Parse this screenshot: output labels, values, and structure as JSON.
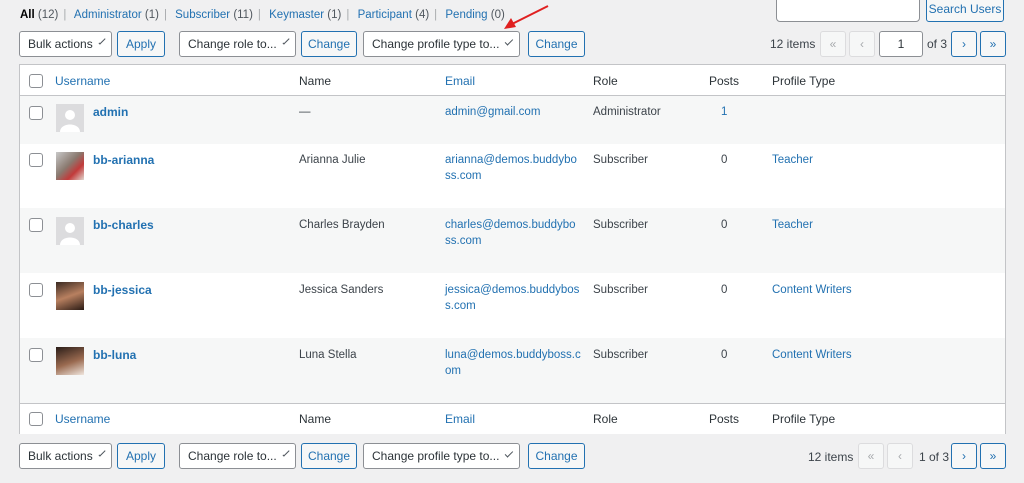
{
  "filters": [
    {
      "label": "All",
      "count": "(12)",
      "current": true
    },
    {
      "label": "Administrator",
      "count": "(1)"
    },
    {
      "label": "Subscriber",
      "count": "(11)"
    },
    {
      "label": "Keymaster",
      "count": "(1)"
    },
    {
      "label": "Participant",
      "count": "(4)"
    },
    {
      "label": "Pending",
      "count": "(0)"
    }
  ],
  "search": {
    "button": "Search Users",
    "value": ""
  },
  "toolbar": {
    "bulk_actions": "Bulk actions",
    "apply": "Apply",
    "change_role": "Change role to...",
    "change": "Change",
    "change_profile_type": "Change profile type to...",
    "change2": "Change"
  },
  "pagination_top": {
    "items": "12 items",
    "first": "«",
    "prev": "‹",
    "current_page": "1",
    "of_total": "of 3",
    "next": "›",
    "last": "»"
  },
  "pagination_bottom": {
    "items": "12 items",
    "first": "«",
    "prev": "‹",
    "page_text": "1 of 3",
    "next": "›",
    "last": "»"
  },
  "columns": {
    "username": "Username",
    "name": "Name",
    "email": "Email",
    "role": "Role",
    "posts": "Posts",
    "profile_type": "Profile Type"
  },
  "users": [
    {
      "username": "admin",
      "name": "—",
      "email": "admin@gmail.com",
      "role": "Administrator",
      "posts": "1",
      "profile_type": ""
    },
    {
      "username": "bb-arianna",
      "name": "Arianna Julie",
      "email": "arianna@demos.buddyboss.com",
      "email_l1": "arianna@demos.buddybo",
      "email_l2": "ss.com",
      "role": "Subscriber",
      "posts": "0",
      "profile_type": "Teacher"
    },
    {
      "username": "bb-charles",
      "name": "Charles Brayden",
      "email_l1": "charles@demos.buddybo",
      "email_l2": "ss.com",
      "role": "Subscriber",
      "posts": "0",
      "profile_type": "Teacher"
    },
    {
      "username": "bb-jessica",
      "name": "Jessica Sanders",
      "email_l1": "jessica@demos.buddybos",
      "email_l2": "s.com",
      "role": "Subscriber",
      "posts": "0",
      "profile_type": "Content Writers"
    },
    {
      "username": "bb-luna",
      "name": "Luna Stella",
      "email_l1": "luna@demos.buddyboss.c",
      "email_l2": "om",
      "role": "Subscriber",
      "posts": "0",
      "profile_type": "Content Writers"
    }
  ],
  "colors": {
    "link": "#2271b1",
    "annotation_arrow": "#e02020"
  }
}
